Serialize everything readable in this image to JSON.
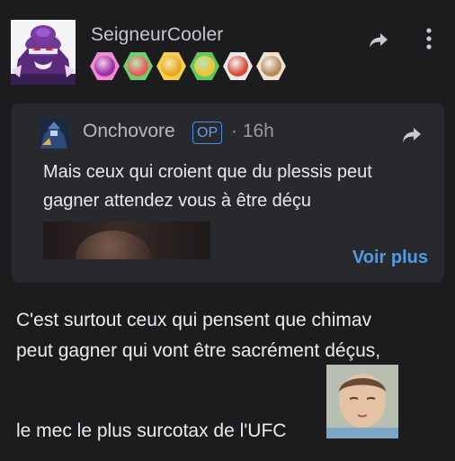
{
  "post": {
    "username": "SeigneurCooler",
    "badges": [
      {
        "icon": "spiral-badge-icon",
        "bg": "#f08bd0",
        "fg": "#9a2fa8"
      },
      {
        "icon": "clown-face-badge-icon",
        "bg": "#6bcf6b",
        "fg": "#e85b5b"
      },
      {
        "icon": "dizzy-face-badge-icon",
        "bg": "#f5d04a",
        "fg": "#e8a72a"
      },
      {
        "icon": "beer-mug-badge-icon",
        "bg": "#5ec95e",
        "fg": "#f3c23a"
      },
      {
        "icon": "chef-badge-icon",
        "bg": "#e8e8e8",
        "fg": "#d84a3a"
      },
      {
        "icon": "monkey-face-badge-icon",
        "bg": "#efe3d0",
        "fg": "#b58a5a"
      }
    ],
    "body_lines": [
      "C'est surtout ceux qui pensent que chimav",
      "peut gagner qui vont être sacrément déçus,",
      "le mec le plus surcotax de l'UFC"
    ]
  },
  "quote": {
    "author": "Onchovore",
    "op_label": "OP",
    "time": "· 16h",
    "text": "Mais ceux qui croient que du plessis peut gagner attendez vous à être déçu",
    "see_more": "Voir plus"
  },
  "colors": {
    "background": "#1c1c1e",
    "card": "#28292d",
    "accent": "#4f9be8"
  }
}
